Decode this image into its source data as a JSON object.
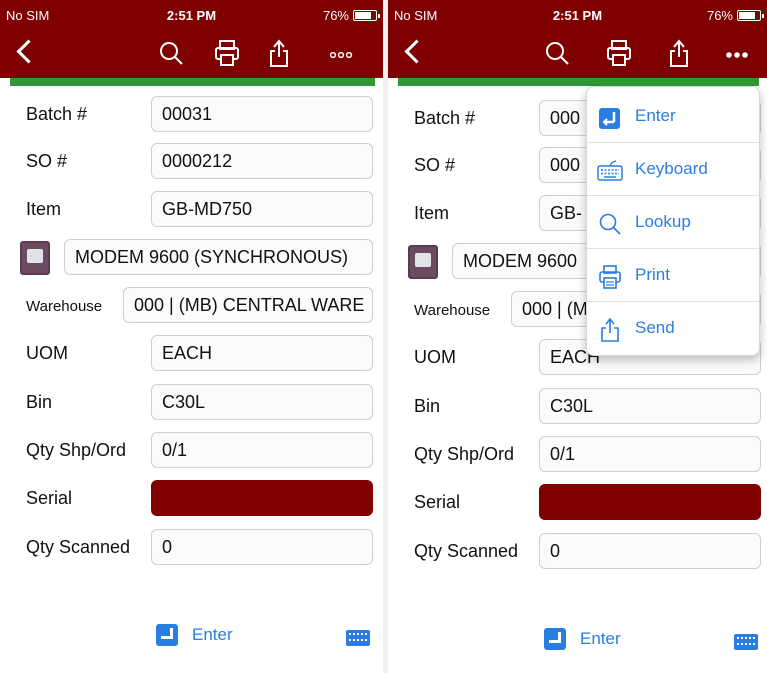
{
  "status": {
    "carrier": "No SIM",
    "time": "2:51 PM",
    "battery": "76%"
  },
  "form": {
    "batch_label": "Batch #",
    "batch_value": "00031",
    "so_label": "SO #",
    "so_value": "0000212",
    "item_label": "Item",
    "item_value": "GB-MD750",
    "description": "MODEM 9600 (SYNCHRONOUS)",
    "warehouse_label": "Warehouse",
    "warehouse_value": "000 | (MB) CENTRAL WARE",
    "uom_label": "UOM",
    "uom_value": "EACH",
    "bin_label": "Bin",
    "bin_value": "C30L",
    "qty_label": "Qty Shp/Ord",
    "qty_value": "0/1",
    "serial_label": "Serial",
    "scanned_label": "Qty Scanned",
    "scanned_value": "0"
  },
  "right_form": {
    "batch_value": "000",
    "so_value": "000",
    "item_value": "GB-",
    "description": "MODEM 9600",
    "warehouse_value": "000 | (M",
    "uom_value": "EACH"
  },
  "bottom": {
    "enter_label": "Enter"
  },
  "menu": {
    "items": [
      {
        "label": "Enter",
        "icon": "enter-icon"
      },
      {
        "label": "Keyboard",
        "icon": "keyboard-icon"
      },
      {
        "label": "Lookup",
        "icon": "search-icon"
      },
      {
        "label": "Print",
        "icon": "printer-icon"
      },
      {
        "label": "Send",
        "icon": "share-icon"
      }
    ]
  },
  "colors": {
    "header": "#7f0000",
    "accent": "#2a7de1",
    "green": "#2f9a35",
    "serial": "#7f0000"
  }
}
